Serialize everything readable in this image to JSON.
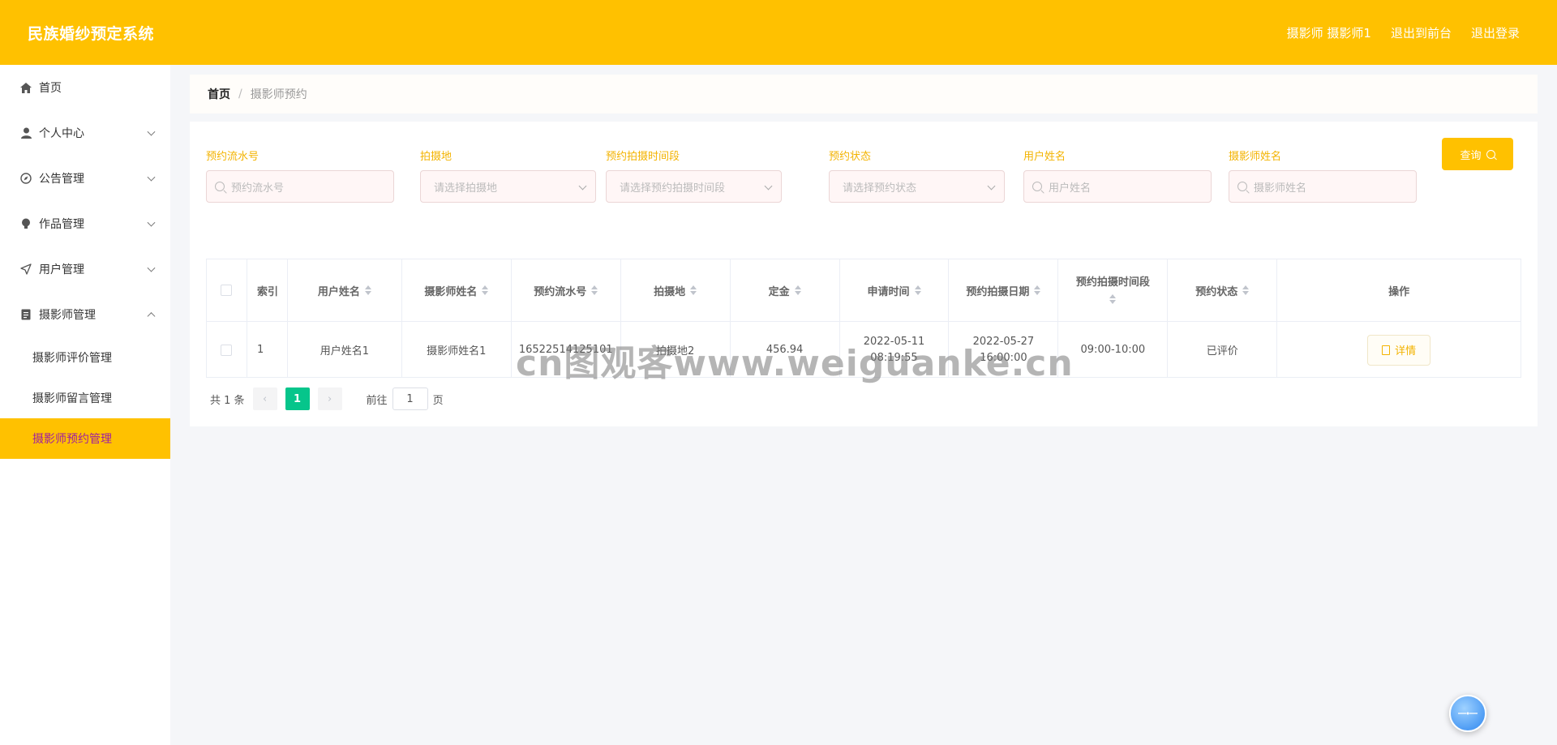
{
  "header": {
    "title": "民族婚纱预定系统",
    "user": "摄影师 摄影师1",
    "to_front": "退出到前台",
    "logout": "退出登录"
  },
  "sidebar": {
    "items": [
      {
        "label": "首页",
        "icon": "home-icon"
      },
      {
        "label": "个人中心",
        "icon": "user-icon"
      },
      {
        "label": "公告管理",
        "icon": "compass-icon"
      },
      {
        "label": "作品管理",
        "icon": "bulb-icon"
      },
      {
        "label": "用户管理",
        "icon": "send-icon"
      },
      {
        "label": "摄影师管理",
        "icon": "document-icon"
      }
    ],
    "sub_items": [
      "摄影师评价管理",
      "摄影师留言管理",
      "摄影师预约管理"
    ]
  },
  "breadcrumb": {
    "home": "首页",
    "sep": "/",
    "current": "摄影师预约"
  },
  "filters": {
    "serial": {
      "label": "预约流水号",
      "placeholder": "预约流水号"
    },
    "location": {
      "label": "拍摄地",
      "placeholder": "请选择拍摄地"
    },
    "period": {
      "label": "预约拍摄时间段",
      "placeholder": "请选择预约拍摄时间段"
    },
    "status": {
      "label": "预约状态",
      "placeholder": "请选择预约状态"
    },
    "username": {
      "label": "用户姓名",
      "placeholder": "用户姓名"
    },
    "photographer": {
      "label": "摄影师姓名",
      "placeholder": "摄影师姓名"
    },
    "query_button": "查询"
  },
  "table": {
    "headers": {
      "index": "索引",
      "username": "用户姓名",
      "photographer": "摄影师姓名",
      "serial": "预约流水号",
      "location": "拍摄地",
      "deposit": "定金",
      "apply_time": "申请时间",
      "shoot_date": "预约拍摄日期",
      "period": "预约拍摄时间段",
      "status": "预约状态",
      "action": "操作"
    },
    "rows": [
      {
        "index": "1",
        "username": "用户姓名1",
        "photographer": "摄影师姓名1",
        "serial": "16522514125101",
        "location": "拍摄地2",
        "deposit": "456.94",
        "apply_time": "2022-05-11 08:19:55",
        "shoot_date": "2022-05-27 16:00:00",
        "period": "09:00-10:00",
        "status": "已评价",
        "action": "详情"
      }
    ]
  },
  "pagination": {
    "total": "共 1 条",
    "prev": "‹",
    "page": "1",
    "next": "›",
    "goto": "前往",
    "goto_value": "1",
    "unit": "页"
  },
  "watermark": "cn图观客www.weiguanke.cn",
  "colors": {
    "accent": "#ffc100",
    "active_text": "#a020a0",
    "page_green": "#06c58b"
  }
}
